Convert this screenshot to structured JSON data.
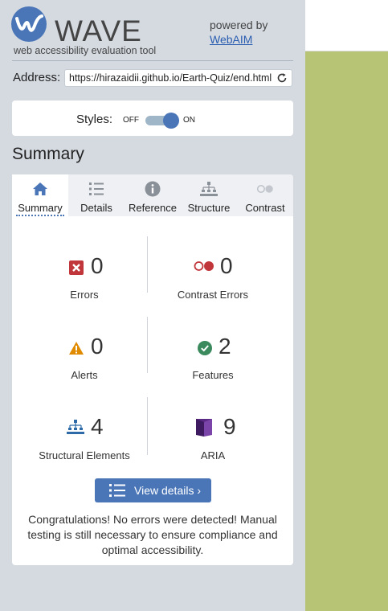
{
  "logo": {
    "title": "WAVE",
    "subtitle": "web accessibility evaluation tool"
  },
  "powered": {
    "text": "powered by",
    "link": "WebAIM"
  },
  "address": {
    "label": "Address:",
    "value": "https://hirazaidii.github.io/Earth-Quiz/end.html"
  },
  "styles": {
    "label": "Styles:",
    "off": "OFF",
    "on": "ON",
    "enabled": true
  },
  "summary_heading": "Summary",
  "tabs": [
    {
      "label": "Summary",
      "icon": "home-icon",
      "active": true
    },
    {
      "label": "Details",
      "icon": "list-icon"
    },
    {
      "label": "Reference",
      "icon": "info-icon"
    },
    {
      "label": "Structure",
      "icon": "hierarchy-icon"
    },
    {
      "label": "Contrast",
      "icon": "contrast-icon"
    }
  ],
  "stats": {
    "errors": {
      "count": "0",
      "label": "Errors",
      "icon": "error-icon"
    },
    "contrast_errors": {
      "count": "0",
      "label": "Contrast Errors",
      "icon": "contrast-error-icon"
    },
    "alerts": {
      "count": "0",
      "label": "Alerts",
      "icon": "alert-icon"
    },
    "features": {
      "count": "2",
      "label": "Features",
      "icon": "feature-check-icon"
    },
    "structural": {
      "count": "4",
      "label": "Structural Elements",
      "icon": "structure-icon"
    },
    "aria": {
      "count": "9",
      "label": "ARIA",
      "icon": "aria-icon"
    }
  },
  "view_details": "View details ›",
  "congrats": "Congratulations! No errors were detected! Manual testing is still necessary to ensure compliance and optimal accessibility.",
  "colors": {
    "accent": "#4a76b8",
    "error": "#c0363a",
    "alert": "#e08a00",
    "feature": "#3a8a5e",
    "aria": "#5b2a86",
    "page": "#b7c375"
  }
}
